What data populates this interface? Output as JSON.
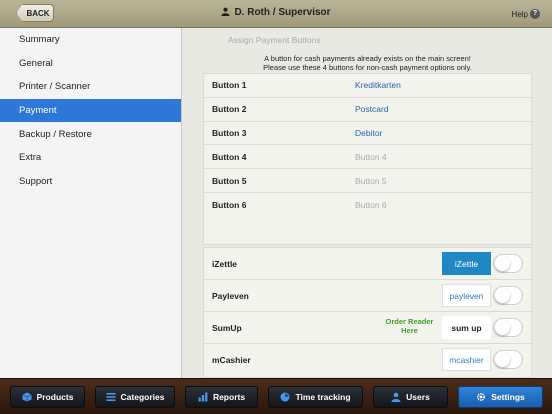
{
  "header": {
    "back_label": "BACK",
    "title": "D. Roth / Supervisor",
    "help_label": "Help"
  },
  "sidebar": {
    "items": [
      {
        "label": "Summary"
      },
      {
        "label": "General"
      },
      {
        "label": "Printer / Scanner"
      },
      {
        "label": "Payment",
        "active": true
      },
      {
        "label": "Backup / Restore"
      },
      {
        "label": "Extra"
      },
      {
        "label": "Support"
      }
    ]
  },
  "main": {
    "section_title": "Assign Payment Buttons",
    "info_line1": "A button for cash payments already exists on the main screen!",
    "info_line2": "Please use these 4 buttons for non-cash payment options only.",
    "buttons": [
      {
        "label": "Button 1",
        "value": "Kreditkarten",
        "empty": false
      },
      {
        "label": "Button 2",
        "value": "Postcard",
        "empty": false
      },
      {
        "label": "Button 3",
        "value": "Debitor",
        "empty": false
      },
      {
        "label": "Button 4",
        "value": "Button 4",
        "empty": true
      },
      {
        "label": "Button 5",
        "value": "Button 5",
        "empty": true
      },
      {
        "label": "Button 6",
        "value": "Button 6",
        "empty": true
      }
    ],
    "providers": [
      {
        "name": "iZettle",
        "logo": "iZettle",
        "enabled": false
      },
      {
        "name": "Payleven",
        "logo": "payleven",
        "enabled": false
      },
      {
        "name": "SumUp",
        "logo": "sum up",
        "order_link": "Order Reader Here",
        "enabled": false
      },
      {
        "name": "mCashier",
        "logo": "mcashier",
        "enabled": false
      }
    ]
  },
  "nav": {
    "products": "Products",
    "categories": "Categories",
    "reports": "Reports",
    "time_tracking": "Time tracking",
    "users": "Users",
    "settings": "Settings"
  },
  "colors": {
    "accent": "#2c77d8",
    "link": "#2f61a8",
    "order_link": "#44a028"
  }
}
